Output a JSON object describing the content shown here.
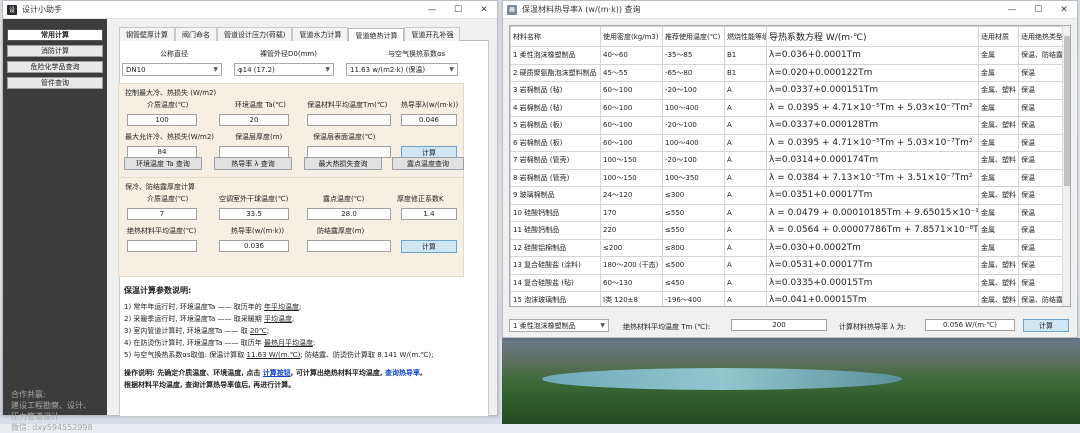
{
  "colors": {
    "sidebar_bg": "#3c3c3c",
    "accent_btn": "#cfe6f5",
    "link_blue": "#1646c8"
  },
  "left_window": {
    "title": "设计小助手",
    "icon_letter": "设",
    "sidebar": {
      "items": [
        "常用计算",
        "消防计算",
        "危险化学品查询",
        "管件查询"
      ],
      "info": [
        "合作共赢:",
        "建设工程勘察、设计、",
        "压力管道设计",
        "微信: dxy594552998"
      ]
    },
    "tabs": [
      "钢管壁厚计算",
      "阀门命名",
      "管道设计压力(荷载)",
      "管道水力计算",
      "管道绝热计算",
      "管道开孔补强"
    ],
    "form": {
      "nominal_diameter_label": "公称直径",
      "nominal_diameter_value": "DN10",
      "outer_diameter_label": "裸管外径D0(mm)",
      "outer_diameter_value": "φ14 (17.2)",
      "heat_coeff_label": "与空气换热系数αs",
      "heat_coeff_value": "11.63 w/(m2·k) (保温)"
    },
    "group1": {
      "title": "控制最大冷、热损失 (W/m2)",
      "labels": [
        "介质温度(℃)",
        "环境温度 Ta(℃)",
        "保温材料平均温度Tm(℃)",
        "热导率λ(w/(m·k))"
      ],
      "values": [
        "100",
        "20",
        "",
        "0.046"
      ],
      "labels2": [
        "最大允许冷、热损失(W/m2)",
        "保温层厚度(m)",
        "保温层表面温度(℃)"
      ],
      "values2": [
        "84",
        "",
        ""
      ],
      "calc": "计算"
    },
    "query_buttons": [
      "环境温度 Ta 查询",
      "热导率 λ 查询",
      "最大热损失查询",
      "露点温度查询"
    ],
    "group2": {
      "title": "保冷、防结露厚度计算",
      "labels": [
        "介质温度(℃)",
        "空调室外干球温度(℃)",
        "露点温度(℃)",
        "厚度修正系数K"
      ],
      "values": [
        "7",
        "33.5",
        "28.0",
        "1.4"
      ],
      "labels2": [
        "绝热材料平均温度(℃)",
        "热导率(w/(m·k))",
        "防结露厚度(m)"
      ],
      "values2": [
        "",
        "0.036",
        ""
      ],
      "calc": "计算"
    },
    "notes": {
      "heading": "保温计算参数说明:",
      "l1a": "1) 常年年运行时, 环境温度Ta —— 取历年的 ",
      "l1b": "年平均温度",
      "l1c": ";",
      "l2a": "2) 采暖季运行时, 环境温度Ta —— 取采暖期 ",
      "l2b": "平均温度",
      "l2c": ";",
      "l3a": "3) 室内管道计算时, 环境温度Ta —— 取 ",
      "l3b": "20℃",
      "l3c": ";",
      "l4a": "4) 在防烫伤计算时, 环境温度Ta —— 取历年 ",
      "l4b": "最热月平均温度",
      "l4c": ";",
      "l5a": "5) 与空气换热系数αs取值: 保温计算取 ",
      "l5b": "11.63 W/(m.℃)",
      "l5c": "; 防结露、防烫伤计算取 8.141 W/(m.℃);",
      "op_a": "操作说明: 先确定介质温度、环境温度, 点击 ",
      "op_b": "计算按钮",
      "op_c": ", 可计算出绝热材料平均温度, ",
      "op_d": "查询热导率",
      "op_e": ",",
      "op2": "根据材料平均温度, 查询计算热导率值后, 再进行计算。"
    }
  },
  "right_window": {
    "title": "保温材料热导率λ (w/(m·k)) 查询",
    "columns": [
      "材料名称",
      "使用密度(kg/m3)",
      "推荐使用温度(℃)",
      "燃烧性能等级",
      "导热系数方程 W/(m·℃)",
      "适用材质",
      "适用绝热类型"
    ],
    "rows": [
      [
        "1 柔性泡沫橡塑制品",
        "40～60",
        "-35～85",
        "B1",
        "λ=0.036+0.0001Tm",
        "金属",
        "保温、防结露"
      ],
      [
        "2 硬质聚氨酯泡沫塑料制品",
        "45～55",
        "-65～80",
        "B1",
        "λ=0.020+0.000122Tm",
        "金属",
        "保温"
      ],
      [
        "3 岩棉制品 (毡)",
        "60～100",
        "-20～100",
        "A",
        "λ=0.0337+0.000151Tm",
        "金属、塑料",
        "保温"
      ],
      [
        "4 岩棉制品 (毡)",
        "60～100",
        "100～400",
        "A",
        "λ = 0.0395 + 4.71×10⁻⁵Tm + 5.03×10⁻⁷Tm²",
        "金属",
        "保温"
      ],
      [
        "5 岩棉制品 (板)",
        "60～100",
        "-20～100",
        "A",
        "λ=0.0337+0.000128Tm",
        "金属、塑料",
        "保温"
      ],
      [
        "6 岩棉制品 (板)",
        "60～100",
        "100～400",
        "A",
        "λ = 0.0395 + 4.71×10⁻⁵Tm + 5.03×10⁻⁷Tm²",
        "金属",
        "保温"
      ],
      [
        "7 岩棉制品 (管壳)",
        "100～150",
        "-20～100",
        "A",
        "λ=0.0314+0.000174Tm",
        "金属、塑料",
        "保温"
      ],
      [
        "8 岩棉制品 (管壳)",
        "100～150",
        "100～350",
        "A",
        "λ = 0.0384 + 7.13×10⁻⁵Tm + 3.51×10⁻⁷Tm²",
        "金属",
        "保温"
      ],
      [
        "9 玻璃棉制品",
        "24～120",
        "≤300",
        "A",
        "λ=0.0351+0.00017Tm",
        "金属、塑料",
        "保温"
      ],
      [
        "10 硅酸钙制品",
        "170",
        "≤550",
        "A",
        "λ = 0.0479 + 0.00010185Tm + 9.65015×10⁻¹¹Tm³",
        "金属",
        "保温"
      ],
      [
        "11 硅酸钙制品",
        "220",
        "≤550",
        "A",
        "λ = 0.0564 + 0.00007786Tm + 7.8571×10⁻⁸Tm²",
        "金属",
        "保温"
      ],
      [
        "12 硅酸铝棉制品",
        "≤200",
        "≤800",
        "A",
        "λ=0.030+0.0002Tm",
        "金属",
        "保温"
      ],
      [
        "13 复合硅酸盐 (涂料)",
        "180～200 (干态)",
        "≤500",
        "A",
        "λ=0.0531+0.00017Tm",
        "金属、塑料",
        "保温"
      ],
      [
        "14 复合硅酸盐 (毡)",
        "60～130",
        "≤450",
        "A",
        "λ=0.0335+0.00015Tm",
        "金属、塑料",
        "保温"
      ],
      [
        "15 泡沫玻璃制品",
        "Ⅰ类 120±8",
        "-196～400",
        "A",
        "λ=0.041+0.00015Tm",
        "金属、塑料",
        "保温、防结露"
      ]
    ],
    "footer": {
      "material_value": "1 柔性泡沫橡塑制品",
      "mean_temp_label": "绝热材料平均温度 Tm (℃):",
      "mean_temp_value": "200",
      "result_label": "计算材料热导率 λ 为:",
      "result_value": "0.056 W/(m·℃)",
      "calc": "计算"
    }
  }
}
